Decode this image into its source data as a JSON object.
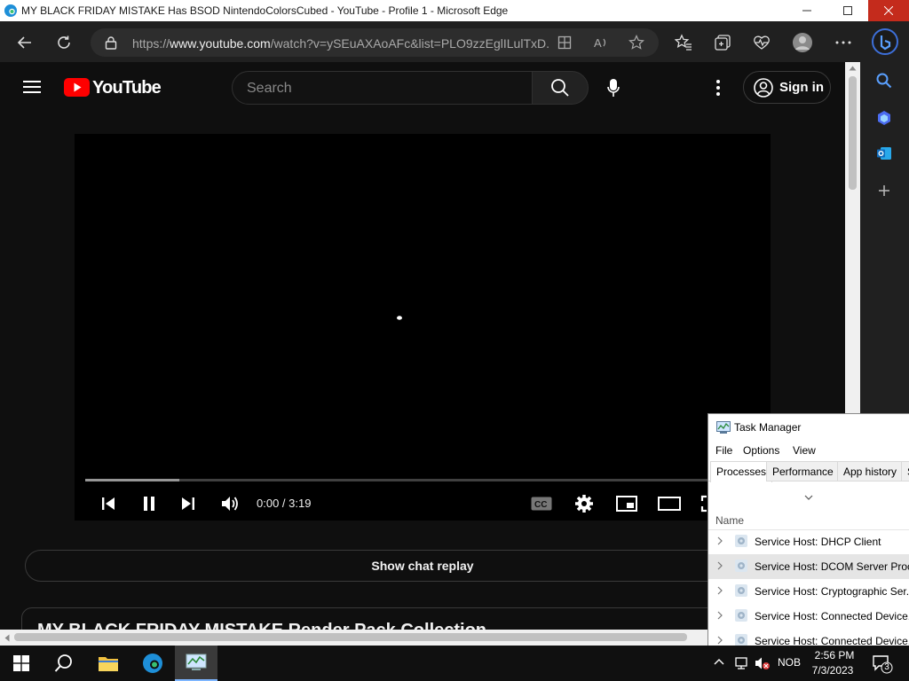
{
  "window": {
    "title": "MY BLACK FRIDAY MISTAKE Has BSOD NintendoColorsCubed - YouTube - Profile 1 - Microsoft Edge"
  },
  "browser": {
    "url_prefix": "https://",
    "url_host": "www.youtube.com",
    "url_path": "/watch?v=ySEuAXAoAFc&list=PLO9zzEglILulTxD..."
  },
  "youtube": {
    "logo_text": "YouTube",
    "search_placeholder": "Search",
    "sign_in_label": "Sign in",
    "player": {
      "time": "0:00 / 3:19",
      "buffered_fraction": 0.14
    },
    "chat_replay_label": "Show chat replay",
    "playlist_title": "MY BLACK FRIDAY MISTAKE Render Pack Collection"
  },
  "task_manager": {
    "title": "Task Manager",
    "menu": [
      "File",
      "Options",
      "View"
    ],
    "tabs": [
      "Processes",
      "Performance",
      "App history",
      "S"
    ],
    "column_name": "Name",
    "processes": [
      "Service Host: DHCP Client",
      "Service Host: DCOM Server Proc...",
      "Service Host: Cryptographic Ser...",
      "Service Host: Connected Device...",
      "Service Host: Connected Device..."
    ],
    "selected_index": 1
  },
  "taskbar": {
    "lang": "NOB",
    "time": "2:56 PM",
    "date": "7/3/2023",
    "notification_count": "3"
  },
  "colors": {
    "youtube_red": "#ff0000",
    "edge_blue": "#0c7bd6",
    "close_red": "#c42b1c"
  }
}
